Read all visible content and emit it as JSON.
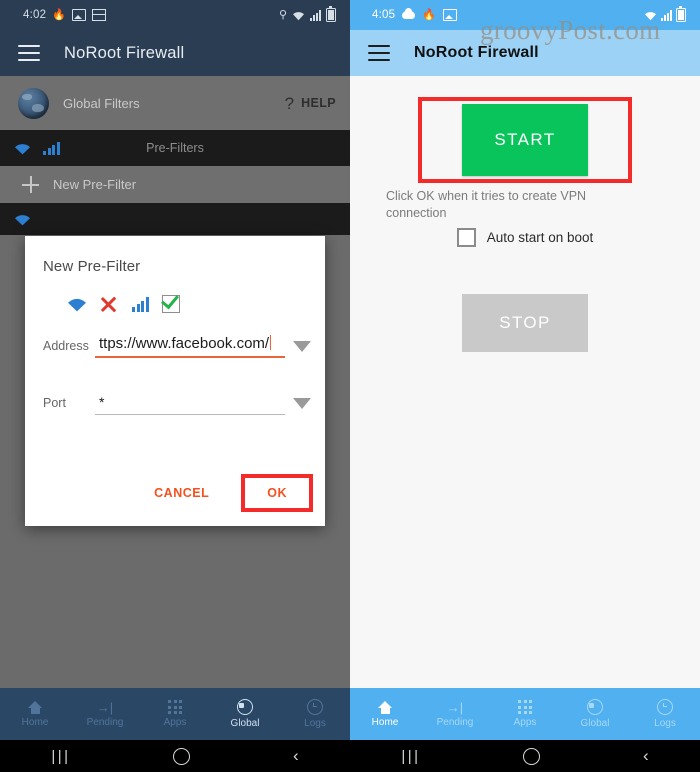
{
  "left_phone": {
    "status_bar": {
      "time": "4:02",
      "icons": [
        "flame-icon",
        "picture-icon",
        "grid-icon"
      ],
      "right_icons": [
        "key-icon",
        "wifi-icon",
        "signal-icon",
        "battery-icon"
      ]
    },
    "app_bar": {
      "menu_icon": "hamburger-menu-icon",
      "title": "NoRoot Firewall"
    },
    "global_row": {
      "icon": "globe-icon",
      "label": "Global Filters",
      "help_question": "?",
      "help_label": "HELP"
    },
    "prefilters_header": {
      "title": "Pre-Filters",
      "icons": [
        "wifi-icon",
        "signal-bars-icon"
      ]
    },
    "new_prefilter_row": {
      "icon": "plus-icon",
      "label": "New Pre-Filter"
    },
    "dialog": {
      "title": "New Pre-Filter",
      "icons": [
        "wifi-icon",
        "red-x-icon",
        "signal-bars-icon",
        "green-check-icon"
      ],
      "address_label": "Address",
      "address_value": "ttps://www.facebook.com/",
      "port_label": "Port",
      "port_value": "*",
      "cancel_label": "CANCEL",
      "ok_label": "OK",
      "highlight_color": "#f42b2b",
      "accent_color": "#f4511e"
    },
    "bottom_nav": {
      "items": [
        {
          "label": "Home",
          "icon": "home-icon",
          "active": false
        },
        {
          "label": "Pending",
          "icon": "arrow-to-line-icon",
          "active": false
        },
        {
          "label": "Apps",
          "icon": "apps-grid-icon",
          "active": false
        },
        {
          "label": "Global",
          "icon": "globe-icon",
          "active": true
        },
        {
          "label": "Logs",
          "icon": "history-clock-icon",
          "active": false
        }
      ]
    },
    "android_nav": {
      "recent": "|||",
      "home": "home-circle-icon",
      "back": "‹"
    }
  },
  "right_phone": {
    "status_bar": {
      "time": "4:05",
      "icons": [
        "cloud-icon",
        "flame-icon",
        "picture-icon"
      ],
      "right_icons": [
        "wifi-icon",
        "signal-icon",
        "battery-icon"
      ]
    },
    "watermark": "groovyPost.com",
    "app_bar": {
      "menu_icon": "hamburger-menu-icon",
      "title": "NoRoot Firewall"
    },
    "main": {
      "start_label": "START",
      "start_color": "#08c45b",
      "start_highlight_color": "#f42b2b",
      "vpn_note": "Click OK when it tries to create VPN connection",
      "autostart_label": "Auto start on boot",
      "autostart_checked": false,
      "stop_label": "STOP",
      "stop_color": "#c9c9c9"
    },
    "bottom_nav": {
      "items": [
        {
          "label": "Home",
          "icon": "home-icon",
          "active": true
        },
        {
          "label": "Pending",
          "icon": "arrow-to-line-icon",
          "active": false
        },
        {
          "label": "Apps",
          "icon": "apps-grid-icon",
          "active": false
        },
        {
          "label": "Global",
          "icon": "globe-icon",
          "active": false
        },
        {
          "label": "Logs",
          "icon": "history-clock-icon",
          "active": false
        }
      ]
    },
    "android_nav": {
      "recent": "|||",
      "home": "home-circle-icon",
      "back": "‹"
    }
  }
}
